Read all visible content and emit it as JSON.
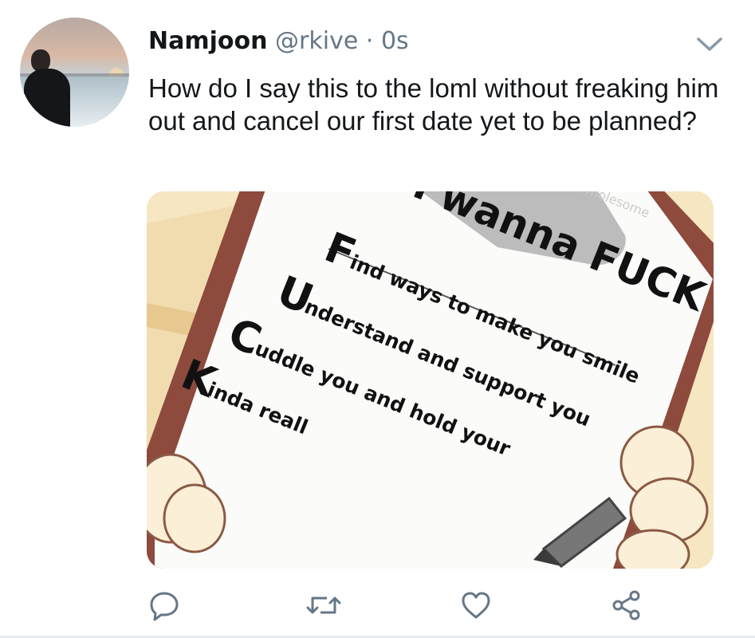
{
  "tweet": {
    "display_name": "Namjoon",
    "handle": "@rkive",
    "separator": "·",
    "time": "0s",
    "text": "How do I say this to the loml without freaking him out and cancel our first date yet to be planned?"
  },
  "media": {
    "meme_title": "I wanna FUCK",
    "watermark": "wholesome",
    "lines": [
      {
        "letter": "F",
        "rest": "ind ways to make you smile"
      },
      {
        "letter": "U",
        "rest": "nderstand and support you"
      },
      {
        "letter": "C",
        "rest": "uddle you and hold your"
      },
      {
        "letter": "K",
        "rest": "inda reall"
      }
    ]
  },
  "icons": {
    "more": "chevron-down-icon",
    "reply": "reply-icon",
    "retweet": "retweet-icon",
    "like": "heart-icon",
    "share": "share-icon"
  },
  "colors": {
    "secondary_text": "#657786",
    "icon": "#657786",
    "text": "#14171a"
  }
}
